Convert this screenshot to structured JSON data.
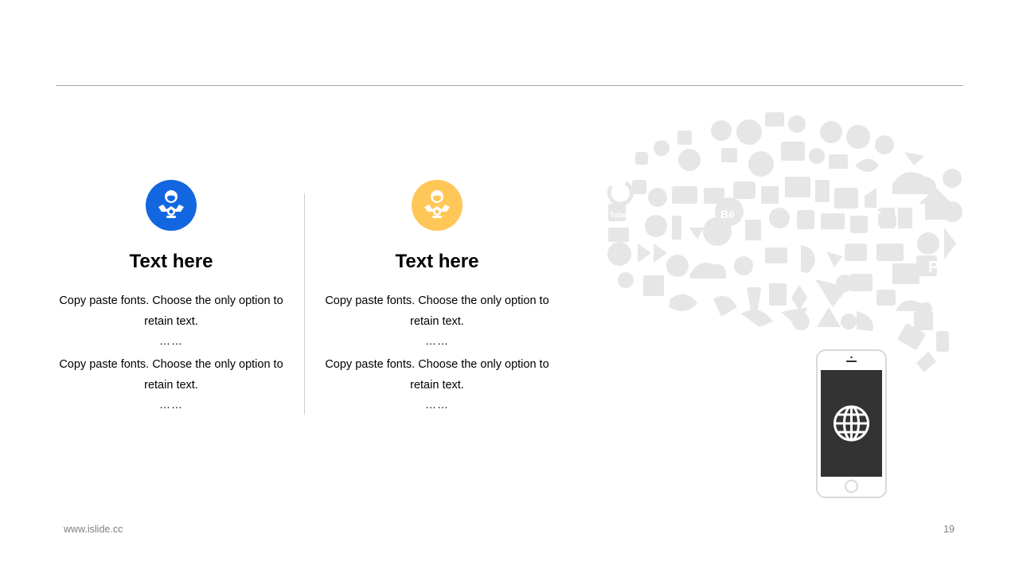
{
  "columns": [
    {
      "id": "left",
      "icon": "service-agent-icon",
      "color": "#1266e0",
      "title": "Text here",
      "paragraphs": [
        "Copy paste fonts. Choose the only option to retain text.",
        "Copy paste fonts. Choose the only option to retain text."
      ],
      "ellipsis": "……"
    },
    {
      "id": "right",
      "icon": "service-agent-icon",
      "color": "#ffc757",
      "title": "Text here",
      "paragraphs": [
        "Copy paste fonts. Choose the only option to retain text.",
        "Copy paste fonts. Choose the only option to retain text."
      ],
      "ellipsis": "……"
    }
  ],
  "illustration": {
    "cloud_icons": "social-media-icon-cloud",
    "cloud_color": "#e6e6e6",
    "cloud_labels": {
      "tube": "Tube",
      "behance": "Bē",
      "linkedin": "in",
      "parking": "P"
    },
    "phone_icon": "globe-icon",
    "phone_screen_color": "#333333"
  },
  "footer": {
    "url": "www.islide.cc",
    "page_number": "19"
  }
}
